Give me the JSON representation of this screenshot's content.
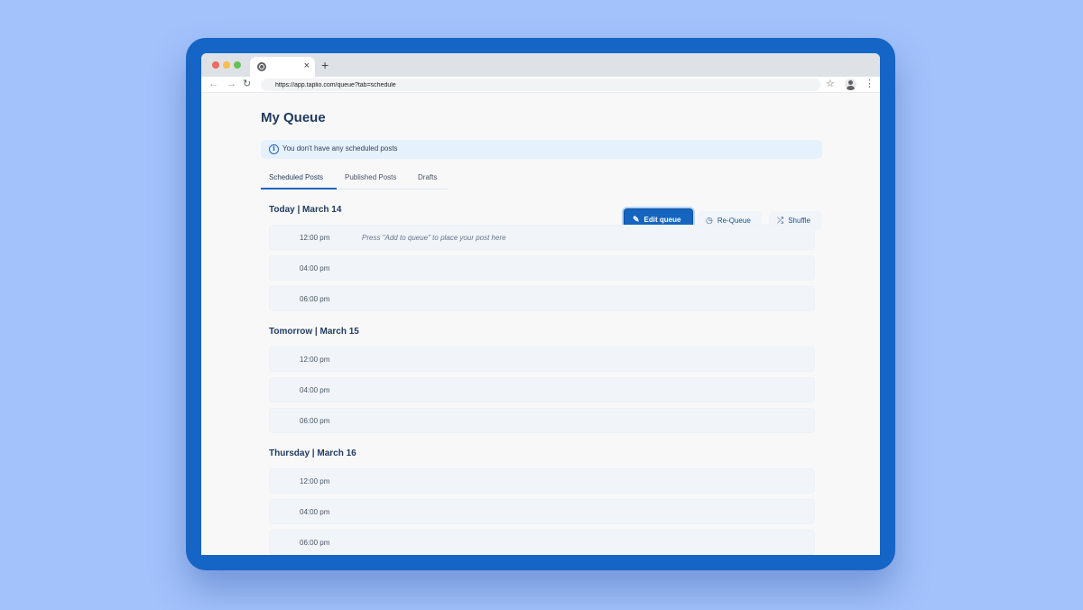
{
  "browser": {
    "url": "https://app.taplio.com/queue?tab=schedule",
    "tab_close": "×",
    "new_tab": "+"
  },
  "icons": {
    "back": "back-arrow-icon",
    "forward": "forward-arrow-icon",
    "reload": "reload-icon",
    "star": "star-icon",
    "profile": "profile-icon",
    "menu": "kebab-menu-icon",
    "info": "info-icon",
    "edit": "edit-icon",
    "requeue": "requeue-icon",
    "shuffle": "shuffle-icon"
  },
  "colors": {
    "accent": "#1565c0",
    "frame": "#1565c6",
    "background": "#a3c2fb"
  },
  "page": {
    "title": "My Queue",
    "notice": "You don't have any scheduled posts"
  },
  "tabs": [
    {
      "label": "Scheduled Posts",
      "active": true
    },
    {
      "label": "Published Posts",
      "active": false
    },
    {
      "label": "Drafts",
      "active": false
    }
  ],
  "actions": {
    "edit_queue": "Edit queue",
    "requeue": "Re-Queue",
    "shuffle": "Shuffle"
  },
  "days": [
    {
      "title": "Today | March 14",
      "slots": [
        {
          "time": "12:00 pm",
          "hint": "Press \"Add to queue\" to place your post here"
        },
        {
          "time": "04:00 pm"
        },
        {
          "time": "06:00 pm"
        }
      ]
    },
    {
      "title": "Tomorrow | March 15",
      "slots": [
        {
          "time": "12:00 pm"
        },
        {
          "time": "04:00 pm"
        },
        {
          "time": "06:00 pm"
        }
      ]
    },
    {
      "title": "Thursday | March 16",
      "slots": [
        {
          "time": "12:00 pm"
        },
        {
          "time": "04:00 pm"
        },
        {
          "time": "06:00 pm"
        }
      ]
    }
  ]
}
